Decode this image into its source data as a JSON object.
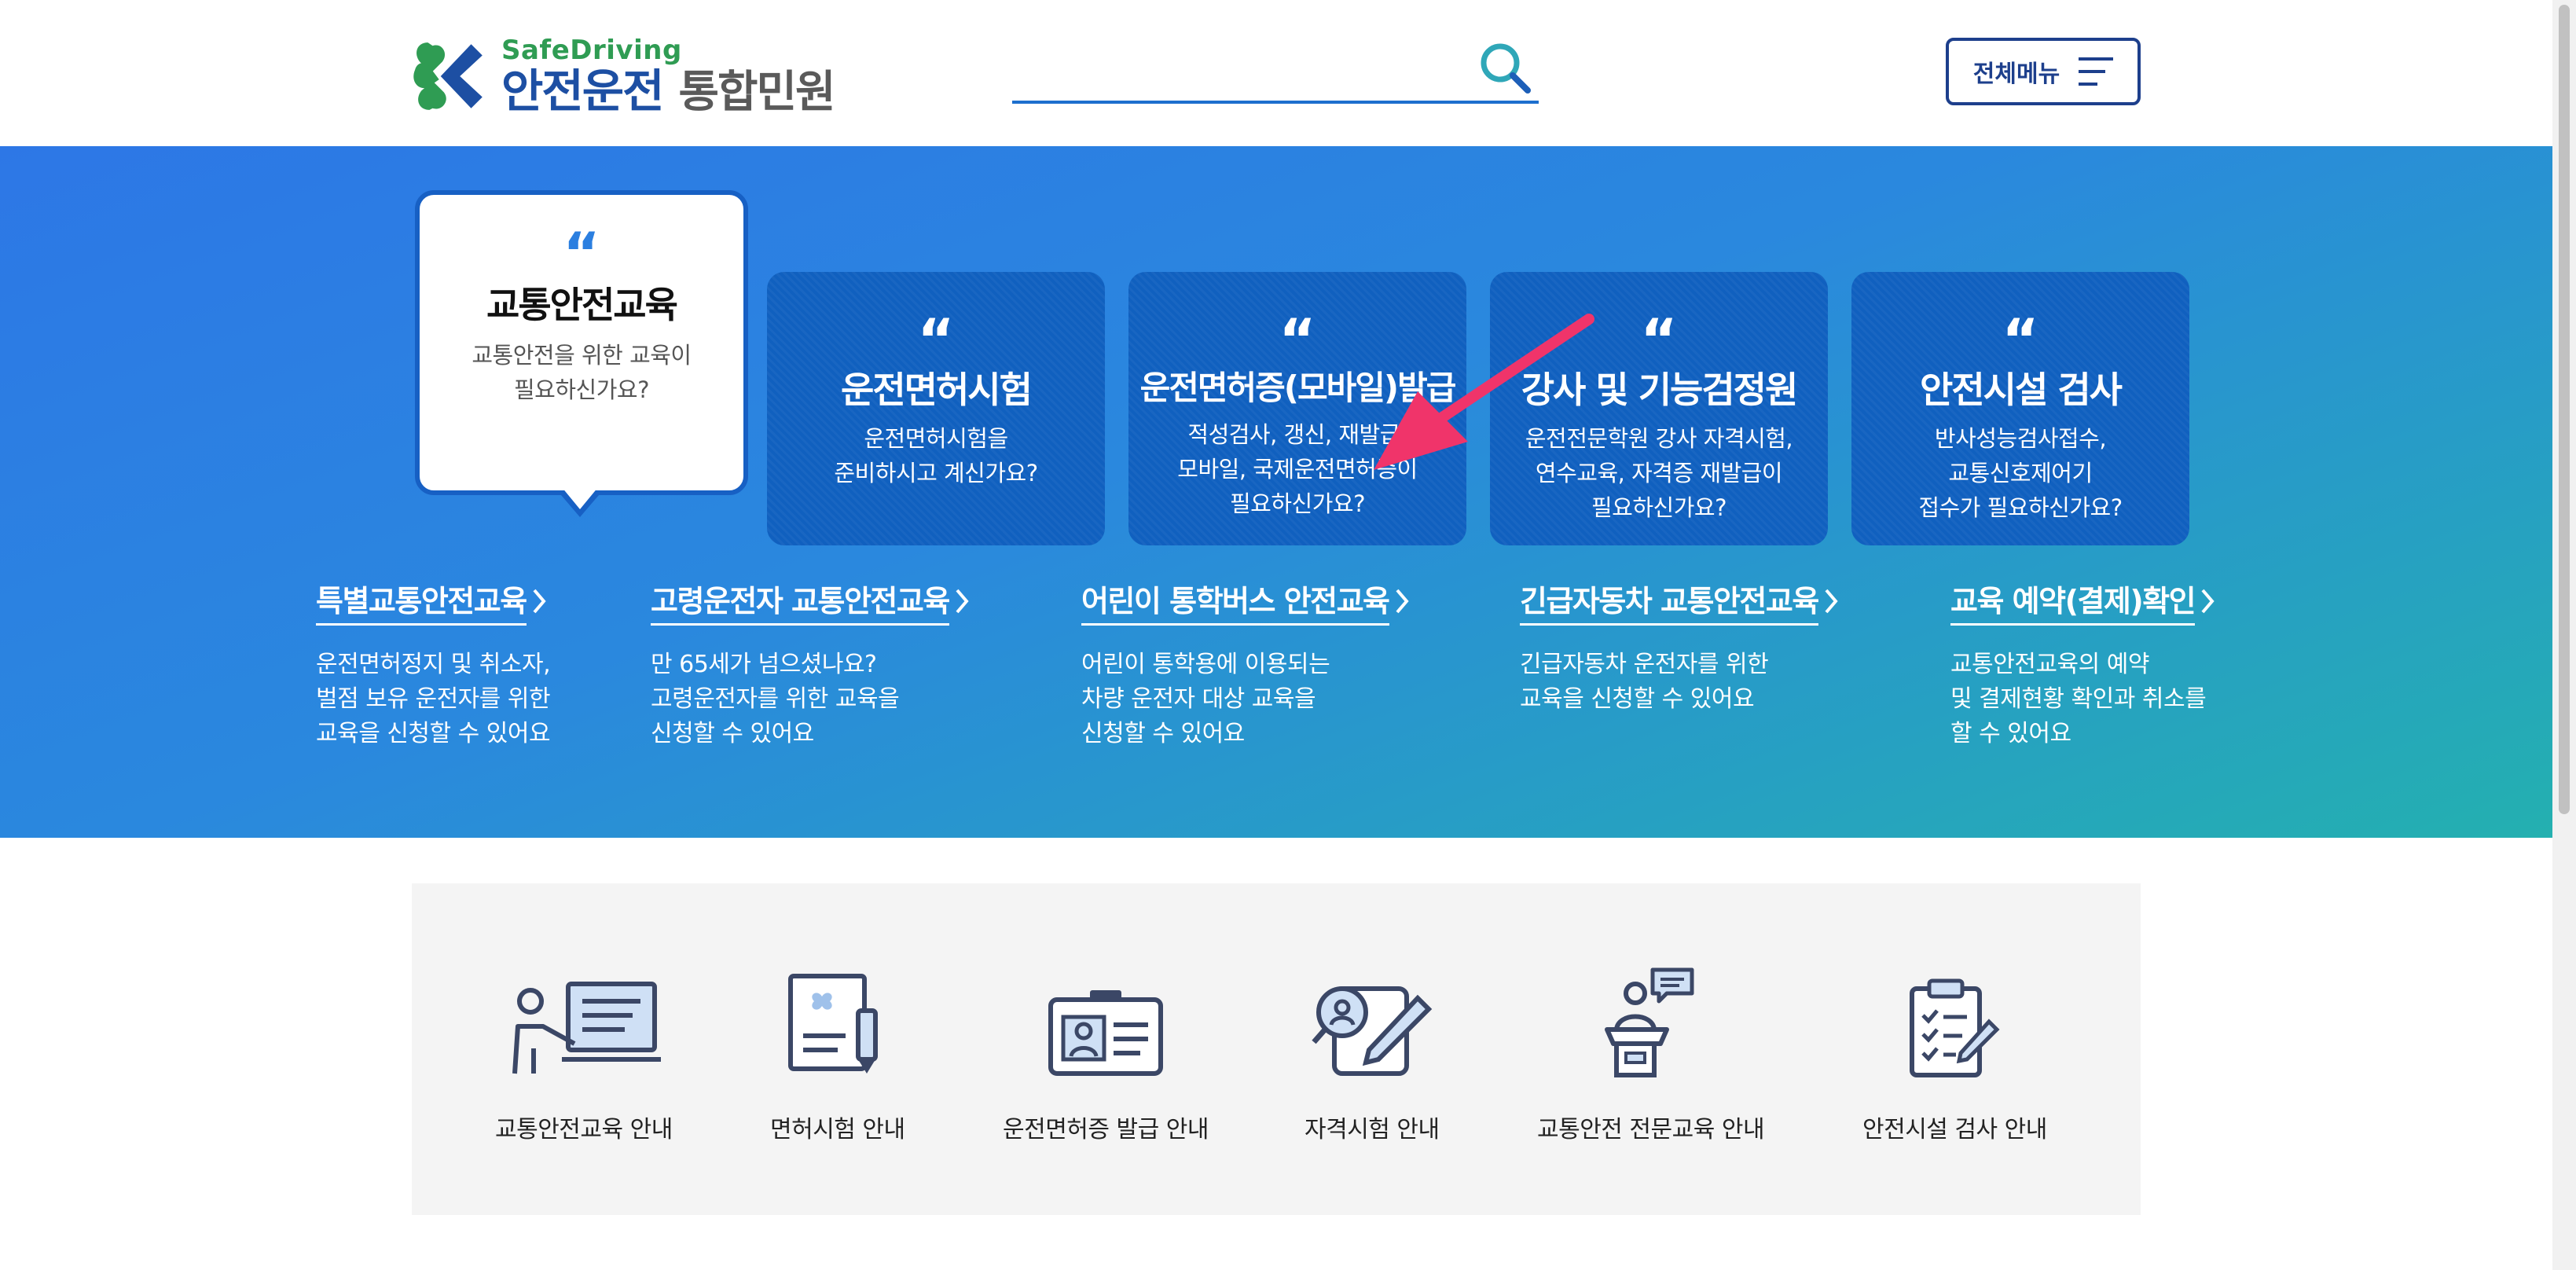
{
  "header": {
    "logo_sub": "SafeDriving",
    "logo_main": "안전운전",
    "logo_suffix": "통합민원",
    "search_value": "",
    "menu_label": "전체메뉴"
  },
  "hero": {
    "active_card": {
      "quote": "“",
      "title": "교통안전교육",
      "desc": "교통안전을 위한 교육이\n필요하신가요?"
    },
    "cards": [
      {
        "quote": "“",
        "title": "운전면허시험",
        "desc": "운전면허시험을\n준비하시고 계신가요?"
      },
      {
        "quote": "“",
        "title": "운전면허증(모바일)발급",
        "desc": "적성검사, 갱신, 재발급,\n모바일, 국제운전면허증이\n필요하신가요?"
      },
      {
        "quote": "“",
        "title": "강사 및 기능검정원",
        "desc": "운전전문학원 강사 자격시험,\n연수교육, 자격증 재발급이\n필요하신가요?"
      },
      {
        "quote": "“",
        "title": "안전시설 검사",
        "desc": "반사성능검사접수,\n교통신호제어기\n접수가 필요하신가요?"
      }
    ],
    "links": [
      {
        "title": "특별교통안전교육",
        "desc": "운전면허정지 및 취소자,\n벌점 보유 운전자를 위한\n교육을 신청할 수 있어요"
      },
      {
        "title": "고령운전자 교통안전교육",
        "desc": "만 65세가 넘으셨나요?\n고령운전자를 위한 교육을\n신청할 수 있어요"
      },
      {
        "title": "어린이 통학버스 안전교육",
        "desc": "어린이 통학용에 이용되는\n차량 운전자 대상 교육을\n신청할 수 있어요"
      },
      {
        "title": "긴급자동차 교통안전교육",
        "desc": "긴급자동차 운전자를 위한\n교육을 신청할 수 있어요"
      },
      {
        "title": "교육 예약(결제)확인",
        "desc": "교통안전교육의 예약\n및 결제현황 확인과 취소를\n할 수 있어요"
      }
    ]
  },
  "services": [
    {
      "label": "교통안전교육 안내",
      "icon": "lecture-icon"
    },
    {
      "label": "면허시험 안내",
      "icon": "license-exam-icon"
    },
    {
      "label": "운전면허증 발급 안내",
      "icon": "id-card-icon"
    },
    {
      "label": "자격시험 안내",
      "icon": "qualification-exam-icon"
    },
    {
      "label": "교통안전 전문교육 안내",
      "icon": "speaker-podium-icon"
    },
    {
      "label": "안전시설 검사 안내",
      "icon": "checklist-icon"
    }
  ],
  "colors": {
    "brand_blue": "#1d4fa3",
    "brand_green": "#2f9c53",
    "card_blue": "#1060bf",
    "annotation_arrow": "#f0346a"
  }
}
